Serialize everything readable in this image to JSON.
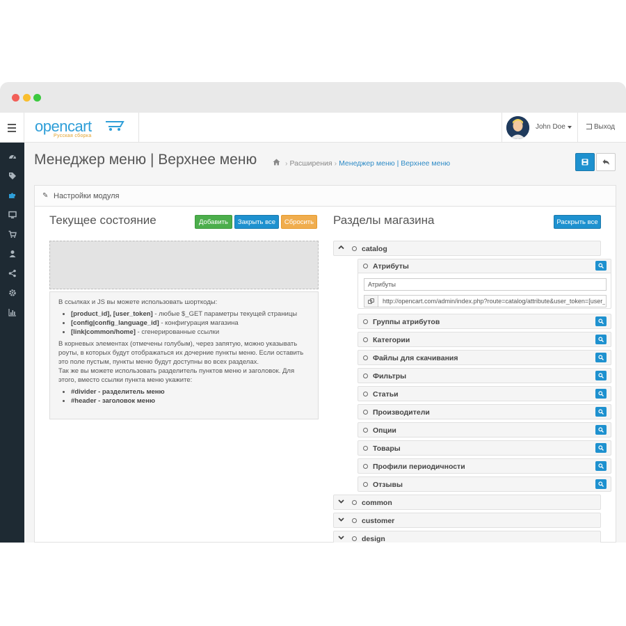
{
  "header": {
    "logo_text": "opencart",
    "logo_subtitle": "Русская сборка",
    "username": "John Doe",
    "logout_label": "Выход"
  },
  "sidebar": {
    "items": [
      "dashboard-icon",
      "tags-icon",
      "puzzle-icon",
      "desktop-icon",
      "cart-icon",
      "user-icon",
      "share-icon",
      "gear-icon",
      "bar-chart-icon"
    ]
  },
  "page": {
    "title": "Менеджер меню | Верхнее меню",
    "breadcrumb": {
      "item1": "Расширения",
      "item2": "Менеджер меню | Верхнее меню"
    }
  },
  "panel": {
    "title": "Настройки модуля"
  },
  "left": {
    "title": "Текущее состояние",
    "btn_add": "Добавить",
    "btn_collapse": "Закрыть все",
    "btn_reset": "Сбросить",
    "help": {
      "intro": "В ссылках и JS вы можете использовать шорткоды:",
      "sc1_code": "[product_id], [user_token]",
      "sc1_text": " - любые $_GET параметры текущей страницы",
      "sc2_code": "[config|config_language_id]",
      "sc2_text": " - конфигурация магазина",
      "sc3_code": "[link|common/home]",
      "sc3_text": " - сгенерированные ссылки",
      "para2": "В корневых элементах (отмечены голубым), через запятую, можно указывать роуты, в которых будут отображаться их дочерние пункты меню. Если оставить это поле пустым, пункты меню будут доступны во всех разделах.",
      "para3": "Так же вы можете использовать разделитель пунктов меню и заголовок. Для этого, вместо ссылки пункта меню укажите:",
      "tag1": "#divider - разделитель меню",
      "tag2": "#header - заголовок меню"
    }
  },
  "right": {
    "title": "Разделы магазина",
    "btn_expand": "Раскрыть все",
    "catalog_label": "catalog",
    "expanded_item": {
      "label": "Атрибуты",
      "name_value": "Атрибуты",
      "url_value": "http://opencart.com/admin/index.php?route=catalog/attribute&user_token=[user_token]"
    },
    "catalog_children": [
      "Группы атрибутов",
      "Категории",
      "Файлы для скачивания",
      "Фильтры",
      "Статьи",
      "Производители",
      "Опции",
      "Товары",
      "Профили периодичности",
      "Отзывы"
    ],
    "sections": [
      "common",
      "customer",
      "design"
    ]
  },
  "colors": {
    "primary": "#1e91cf",
    "success": "#4cae4c",
    "warning": "#f0ad4e",
    "sidebar": "#1e2a33"
  }
}
